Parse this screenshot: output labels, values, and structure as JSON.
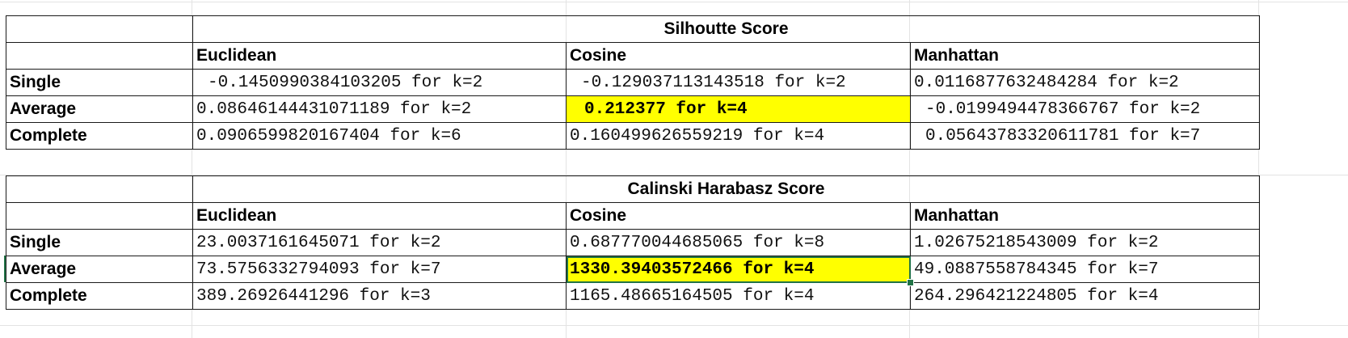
{
  "silhouette": {
    "title": "Silhoutte Score",
    "headers": [
      "Euclidean",
      "Cosine",
      "Manhattan"
    ],
    "rows": [
      {
        "label": "Single",
        "values": [
          "-0.1450990384103205 for k=2",
          "-0.129037113143518 for k=2",
          "0.0116877632484284 for k=2"
        ]
      },
      {
        "label": "Average",
        "values": [
          "0.08646144431071189 for k=2",
          "0.212377 for k=4",
          "-0.0199494478366767 for k=2"
        ]
      },
      {
        "label": "Complete",
        "values": [
          "0.0906599820167404 for k=6",
          "0.160499626559219 for k=4",
          "0.05643783320611781 for k=7"
        ]
      }
    ]
  },
  "calinski": {
    "title": "Calinski Harabasz Score",
    "headers": [
      "Euclidean",
      "Cosine",
      "Manhattan"
    ],
    "rows": [
      {
        "label": "Single",
        "values": [
          "23.0037161645071 for k=2",
          "0.687770044685065 for k=8",
          "1.02675218543009 for k=2"
        ]
      },
      {
        "label": "Average",
        "values": [
          "73.5756332794093 for k=7",
          "1330.39403572466 for k=4",
          "49.0887558784345 for k=7"
        ]
      },
      {
        "label": "Complete",
        "values": [
          "389.26926441296 for k=3",
          "1165.48665164505 for k=4",
          "264.296421224805 for k=4"
        ]
      }
    ]
  },
  "highlight_color": "#ffff00",
  "selection_color": "#217346"
}
